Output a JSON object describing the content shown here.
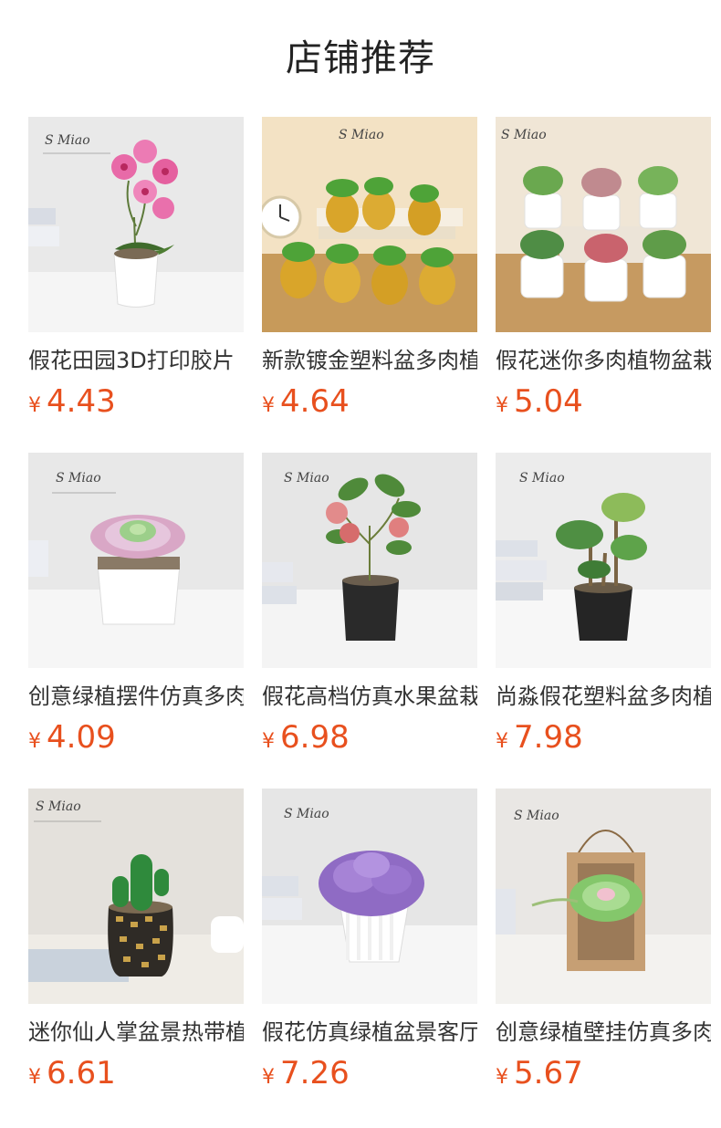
{
  "header": {
    "title": "店铺推荐"
  },
  "colors": {
    "price": "#e8501e",
    "text": "#333333"
  },
  "currency": "¥",
  "products": [
    {
      "name": "假花田园3D打印胶片",
      "price": "4.43",
      "image": "pink-orchid-pot-image"
    },
    {
      "name": "新款镀金塑料盆多肉植",
      "price": "4.64",
      "image": "gold-pineapple-succulents-image"
    },
    {
      "name": "假花迷你多肉植物盆栽",
      "price": "5.04",
      "image": "mini-succulent-pots-image"
    },
    {
      "name": "创意绿植摆件仿真多肉",
      "price": "4.09",
      "image": "pink-succulent-square-pot-image"
    },
    {
      "name": "假花高档仿真水果盆栽",
      "price": "6.98",
      "image": "fruit-plant-black-pot-image"
    },
    {
      "name": "尚淼假花塑料盆多肉植",
      "price": "7.98",
      "image": "succulent-cluster-black-pot-image"
    },
    {
      "name": "迷你仙人掌盆景热带植",
      "price": "6.61",
      "image": "cactus-woven-pot-image"
    },
    {
      "name": "假花仿真绿植盆景客厅",
      "price": "7.26",
      "image": "purple-flower-white-pot-image"
    },
    {
      "name": "创意绿植壁挂仿真多肉",
      "price": "5.67",
      "image": "succulent-wall-frame-image"
    }
  ]
}
